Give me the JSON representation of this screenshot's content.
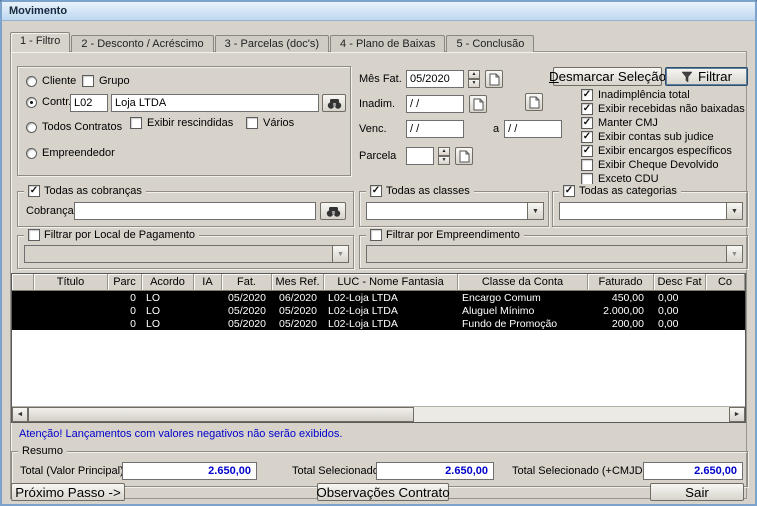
{
  "window": {
    "title": "Movimento"
  },
  "tabs": [
    "1 - Filtro",
    "2 - Desconto / Acréscimo",
    "3 - Parcelas (doc's)",
    "4 - Plano de Baixas",
    "5 - Conclusão"
  ],
  "icons": {
    "check": "✓",
    "spin_up": "▲",
    "spin_down": "▼",
    "dropdown": "▼",
    "scroll_left": "◄",
    "scroll_right": "►"
  },
  "contract_box": {
    "cliente": "Cliente",
    "grupo": "Grupo",
    "contr": "Contr.",
    "contr_code": "L02",
    "contr_name": "Loja LTDA",
    "exibir_rescindidas": "Exibir rescindidas",
    "varios": "Vários",
    "todos_contratos": "Todos Contratos",
    "empreendedor": "Empreendedor"
  },
  "date_filters": {
    "mes_fat_label": "Mês Fat.",
    "mes_fat_value": "05/2020",
    "inadim_label": "Inadim.",
    "inadim_value": "/  /",
    "venc_label": "Venc.",
    "venc_from": "/  /",
    "venc_sep": "a",
    "venc_to": "/  /",
    "parcela_label": "Parcela",
    "parcela_value": ""
  },
  "actions": {
    "desmarcar_initial": "D",
    "desmarcar_rest": "esmarcar Seleção",
    "filtrar": "Filtrar"
  },
  "option_list": [
    {
      "label": "Inadimplência total",
      "checked": true
    },
    {
      "label": "Exibir recebidas não baixadas",
      "checked": true
    },
    {
      "label": "Manter CMJ",
      "checked": true
    },
    {
      "label": "Exibir contas sub judice",
      "checked": true
    },
    {
      "label": "Exibir encargos específicos",
      "checked": true
    },
    {
      "label": "Exibir Cheque Devolvido",
      "checked": false
    },
    {
      "label": "Exceto CDU",
      "checked": false
    }
  ],
  "cobrancas_box": {
    "title": "Todas as cobranças",
    "checked": true,
    "cobranca_label": "Cobrança",
    "cobranca_value": ""
  },
  "classes_box": {
    "title": "Todas as classes",
    "checked": true,
    "selected": ""
  },
  "categorias_box": {
    "title": "Todas as categorias",
    "checked": true,
    "selected": ""
  },
  "local_pagamento_box": {
    "title": "Filtrar por Local de Pagamento",
    "checked": false,
    "selected": ""
  },
  "empreendimento_box": {
    "title": "Filtrar por Empreendimento",
    "checked": false,
    "selected": ""
  },
  "grid": {
    "columns": [
      "",
      "Título",
      "Parc",
      "Acordo",
      "IA",
      "Fat.",
      "Mes Ref.",
      "LUC - Nome Fantasia",
      "Classe da Conta",
      "Faturado",
      "Desc Fat",
      "Co"
    ],
    "rows": [
      {
        "titulo": "",
        "parc": "0",
        "acordo": "LO",
        "ia": "",
        "fat": "05/2020",
        "mes_ref": "06/2020",
        "luc": "L02-Loja LTDA",
        "classe": "Encargo Comum",
        "faturado": "450,00",
        "desc_fat": "0,00",
        "co": ""
      },
      {
        "titulo": "",
        "parc": "0",
        "acordo": "LO",
        "ia": "",
        "fat": "05/2020",
        "mes_ref": "05/2020",
        "luc": "L02-Loja LTDA",
        "classe": "Aluguel Mínimo",
        "faturado": "2.000,00",
        "desc_fat": "0,00",
        "co": ""
      },
      {
        "titulo": "",
        "parc": "0",
        "acordo": "LO",
        "ia": "",
        "fat": "05/2020",
        "mes_ref": "05/2020",
        "luc": "L02-Loja LTDA",
        "classe": "Fundo de Promoção",
        "faturado": "200,00",
        "desc_fat": "0,00",
        "co": ""
      }
    ]
  },
  "warning": "Atenção! Lançamentos com valores negativos não serão exibidos.",
  "resumo": {
    "title": "Resumo",
    "total_principal_label": "Total (Valor Principal)",
    "total_principal_value": "2.650,00",
    "total_selecionado_label": "Total Selecionado",
    "total_selecionado_value": "2.650,00",
    "total_selecionado_cmjd_label": "Total Selecionado (+CMJD)",
    "total_selecionado_cmjd_value": "2.650,00"
  },
  "footer": {
    "proximo": "Próximo Passo ->",
    "observacoes": "Observações Contrato",
    "sair": "Sair"
  }
}
